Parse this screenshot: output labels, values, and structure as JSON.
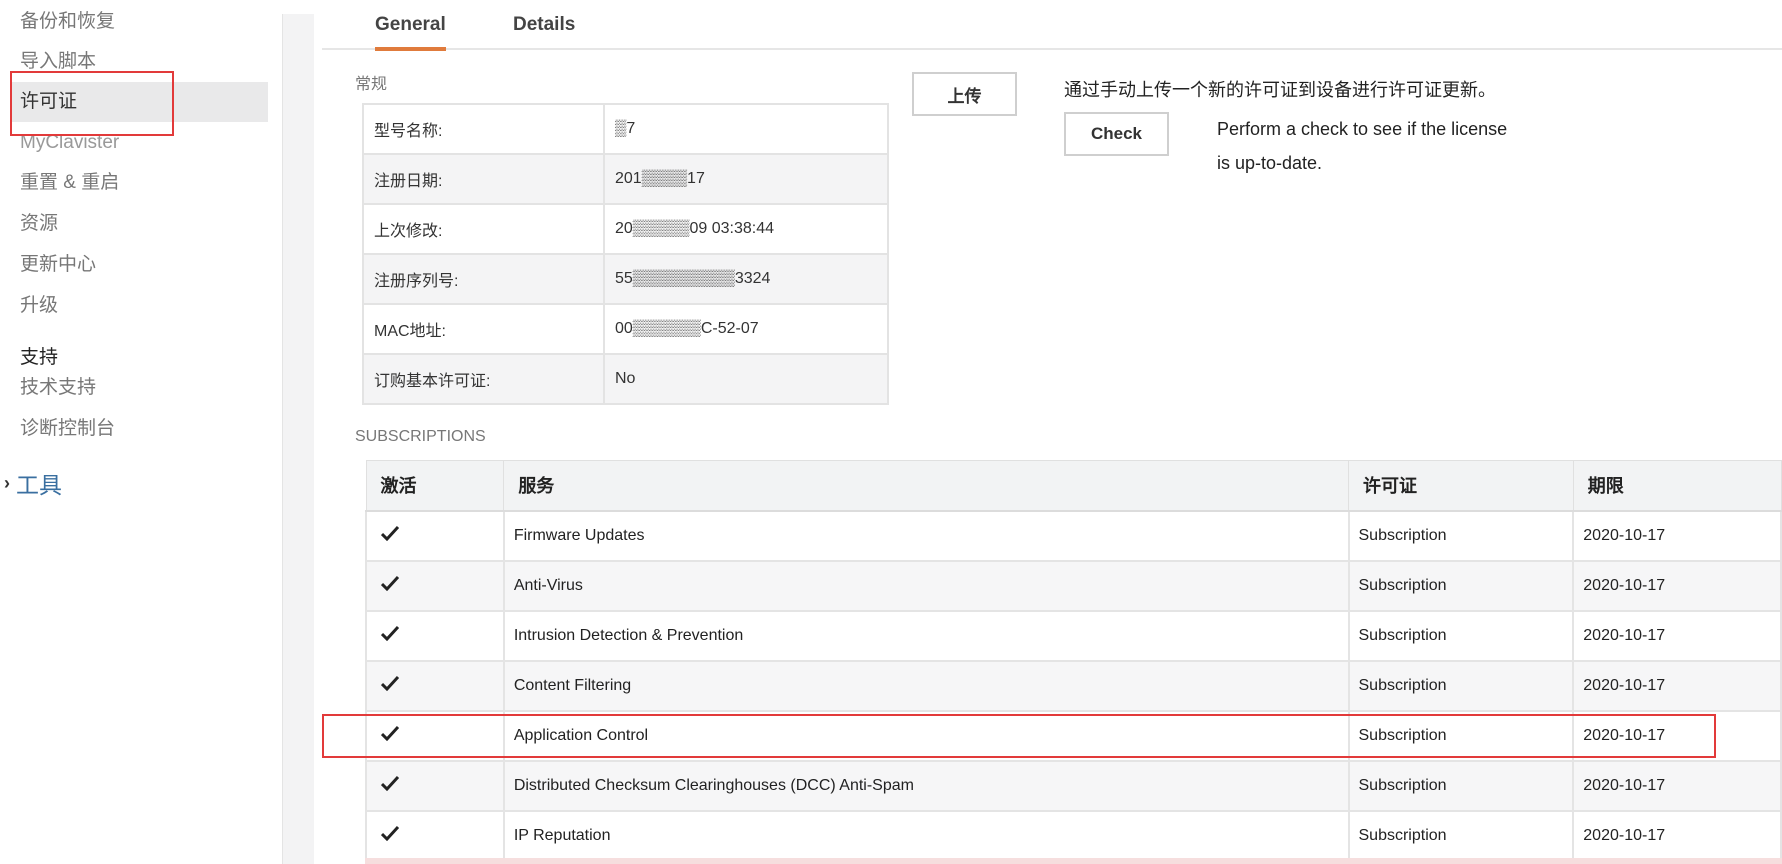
{
  "sidebar": {
    "items": [
      {
        "label": "备份和恢复"
      },
      {
        "label": "导入脚本"
      },
      {
        "label": "许可证"
      },
      {
        "label": "MyClavister"
      },
      {
        "label": "重置 & 重启"
      },
      {
        "label": "资源"
      },
      {
        "label": "更新中心"
      },
      {
        "label": "升级"
      }
    ],
    "support_heading": "支持",
    "support_items": [
      {
        "label": "技术支持"
      },
      {
        "label": "诊断控制台"
      }
    ],
    "tools_label": "工具",
    "active_item": "许可证"
  },
  "tabs": [
    {
      "label": "General"
    },
    {
      "label": "Details"
    }
  ],
  "general": {
    "section_title": "常规",
    "rows": [
      {
        "key": "型号名称:",
        "value": "▒7"
      },
      {
        "key": "注册日期:",
        "value": "201▒▒▒▒17"
      },
      {
        "key": "上次修改:",
        "value": "20▒▒▒▒▒09 03:38:44"
      },
      {
        "key": "注册序列号:",
        "value": "55▒▒▒▒▒▒▒▒▒3324"
      },
      {
        "key": "MAC地址:",
        "value": "00▒▒▒▒▒▒C-52-07"
      },
      {
        "key": "订购基本许可证:",
        "value": "No"
      }
    ]
  },
  "upload": {
    "button_label": "上传",
    "description": "通过手动上传一个新的许可证到设备进行许可证更新。"
  },
  "check": {
    "button_label": "Check",
    "description": "Perform a check to see if the license is up-to-date."
  },
  "subscriptions": {
    "section_title": "SUBSCRIPTIONS",
    "headers": [
      "激活",
      "服务",
      "许可证",
      "期限"
    ],
    "rows": [
      {
        "active": true,
        "service": "Firmware Updates",
        "license": "Subscription",
        "expiry": "2020-10-17"
      },
      {
        "active": true,
        "service": "Anti-Virus",
        "license": "Subscription",
        "expiry": "2020-10-17"
      },
      {
        "active": true,
        "service": "Intrusion Detection & Prevention",
        "license": "Subscription",
        "expiry": "2020-10-17"
      },
      {
        "active": true,
        "service": "Content Filtering",
        "license": "Subscription",
        "expiry": "2020-10-17"
      },
      {
        "active": true,
        "service": "Application Control",
        "license": "Subscription",
        "expiry": "2020-10-17"
      },
      {
        "active": true,
        "service": "Distributed Checksum Clearinghouses (DCC) Anti-Spam",
        "license": "Subscription",
        "expiry": "2020-10-17"
      },
      {
        "active": true,
        "service": "IP Reputation",
        "license": "Subscription",
        "expiry": "2020-10-17"
      }
    ]
  },
  "colors": {
    "accent_tab": "#e07b3c",
    "highlight": "#e23a3a",
    "link": "#3a6fa0"
  }
}
